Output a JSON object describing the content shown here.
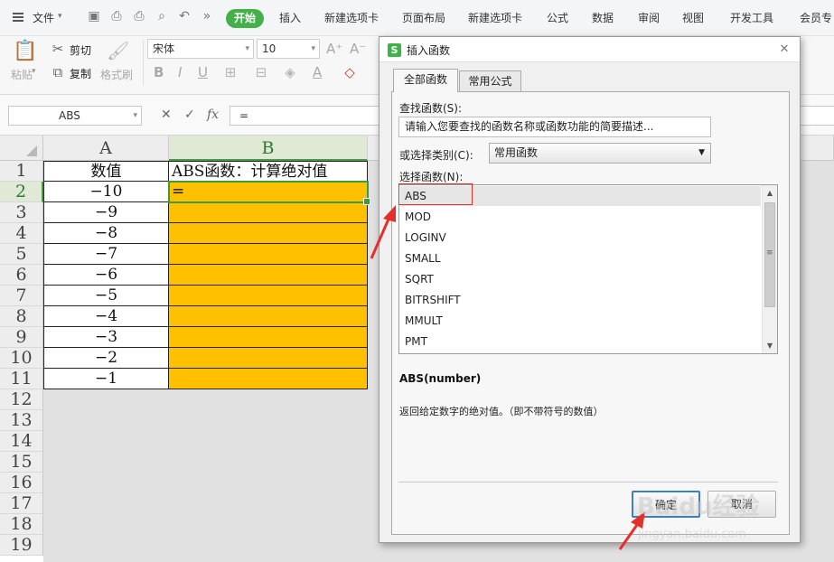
{
  "topbar": {
    "file_label": "文件",
    "more_glyph": "»",
    "tabs": [
      "开始",
      "插入",
      "新建选项卡",
      "页面布局",
      "新建选项卡",
      "公式",
      "数据",
      "审阅",
      "视图",
      "开发工具",
      "会员专"
    ],
    "active_tab": "开始",
    "quick_icons": [
      "save-icon",
      "print-preview-icon",
      "print-icon",
      "zoom-icon",
      "undo-icon",
      "redo-icon"
    ]
  },
  "ribbon": {
    "paste_label": "粘贴",
    "cut_label": "剪切",
    "copy_label": "复制",
    "format_painter_label": "格式刷",
    "font_name": "宋体",
    "font_size": "10",
    "grow_font": "A⁺",
    "shrink_font": "A⁻",
    "bold": "B",
    "italic": "I",
    "underline": "U",
    "font_color_glyph": "A"
  },
  "formula_bar": {
    "name_box": "ABS",
    "cancel_glyph": "✕",
    "confirm_glyph": "✓",
    "fx_label": "fx",
    "formula": "="
  },
  "sheet": {
    "columns": [
      "A",
      "B"
    ],
    "selected_column": "B",
    "row_numbers": [
      "1",
      "2",
      "3",
      "4",
      "5",
      "6",
      "7",
      "8",
      "9",
      "10",
      "11",
      "12",
      "13",
      "14",
      "15",
      "16",
      "17",
      "18",
      "19"
    ],
    "selected_row": "2",
    "header_a": "数值",
    "header_b": "ABS函数：计算绝对值",
    "values": [
      "−10",
      "−9",
      "−8",
      "−7",
      "−6",
      "−5",
      "−4",
      "−3",
      "−2",
      "−1"
    ],
    "b2_content": "=",
    "fill_color": "#ffc000",
    "active_border_color": "#3f9a3b"
  },
  "dialog": {
    "title": "插入函数",
    "logo_letter": "S",
    "close_glyph": "✕",
    "tabs": [
      "全部函数",
      "常用公式"
    ],
    "active_tab": "全部函数",
    "search_label": "查找函数(S):",
    "search_placeholder": "请输入您要查找的函数名称或函数功能的简要描述...",
    "category_label": "或选择类别(C):",
    "category_value": "常用函数",
    "list_label": "选择函数(N):",
    "functions": [
      "ABS",
      "MOD",
      "LOGINV",
      "SMALL",
      "SQRT",
      "BITRSHIFT",
      "MMULT",
      "PMT"
    ],
    "selected_function": "ABS",
    "signature": "ABS(number)",
    "description": "返回给定数字的绝对值。（即不带符号的数值）",
    "ok_label": "确定",
    "cancel_label": "取消"
  },
  "annotation": {
    "highlight_color": "#e5302a"
  },
  "watermark": {
    "brand": "Baidu经验",
    "url": "jingyan.baidu.com"
  }
}
